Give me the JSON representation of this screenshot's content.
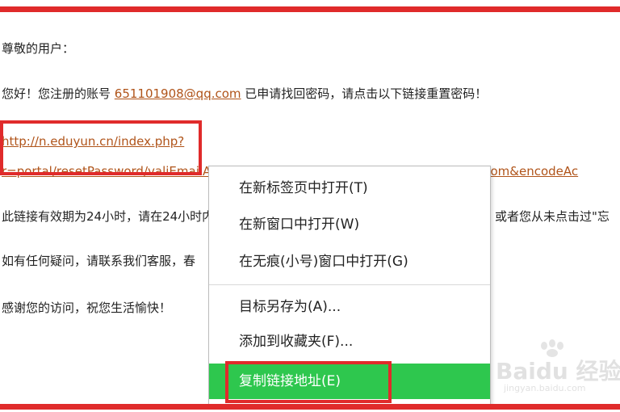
{
  "email": {
    "greeting": "尊敬的用户：",
    "intro_prefix": "您好！您注册的账号 ",
    "account_email": "651101908@qq.com",
    "intro_suffix": " 已申请找回密码，请点击以下链接重置密码！",
    "url_line1": "http://n.eduyun.cn/index.php?",
    "url_line2": "r=portal/resetPassword/valiEmailAuthCode&userIdEmail=651101908%2540qq.com&encodeAc",
    "validity_text": "此链接有效期为24小时，请在24小时内点击链接进行修改。",
    "validity_tail": "或者您从未点击过\"忘",
    "contact_text": "如有任何疑问，请联系我们客服，春",
    "thanks_text": "感谢您的访问，祝您生活愉快！"
  },
  "context_menu": {
    "items": [
      {
        "label": "在新标签页中打开(T)"
      },
      {
        "label": "在新窗口中打开(W)"
      },
      {
        "label": "在无痕(小号)窗口中打开(G)"
      },
      {
        "label": "目标另存为(A)..."
      },
      {
        "label": "添加到收藏夹(F)..."
      },
      {
        "label": "复制链接地址(E)"
      }
    ]
  },
  "watermark": {
    "logo": "Baidu 经验",
    "url": "jingyan.baidu.com"
  },
  "colors": {
    "highlight_border": "#e02b2b",
    "menu_selected": "#2ec74e",
    "link": "#b0541a"
  }
}
